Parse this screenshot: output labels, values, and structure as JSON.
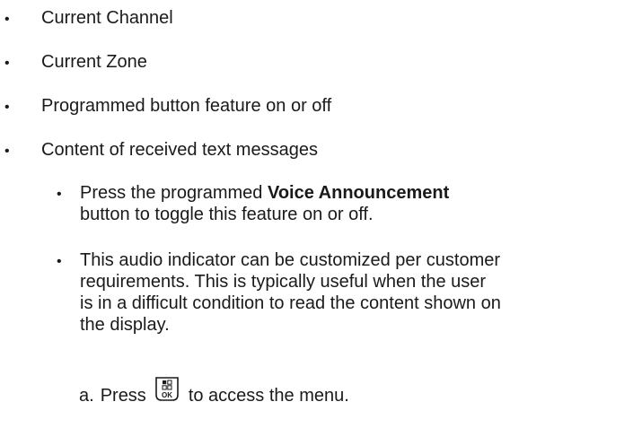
{
  "bullets": [
    "Current Channel",
    "Current Zone",
    "Programmed button feature on or off",
    "Content of received text messages"
  ],
  "sub_bullets": {
    "first": {
      "prefix": "Press the programmed ",
      "bold": "Voice Announcement",
      "line2": "button to toggle this feature on or off."
    },
    "second": {
      "lines": [
        "This audio indicator can be customized per customer",
        "requirements. This is typically useful when the user",
        "is in a difficult condition to read the content shown on",
        "the display."
      ]
    }
  },
  "step": {
    "marker": "a.",
    "before": "Press",
    "key_icon": "menu-ok-key-icon",
    "key_label": "OK",
    "after": "to access the menu."
  }
}
